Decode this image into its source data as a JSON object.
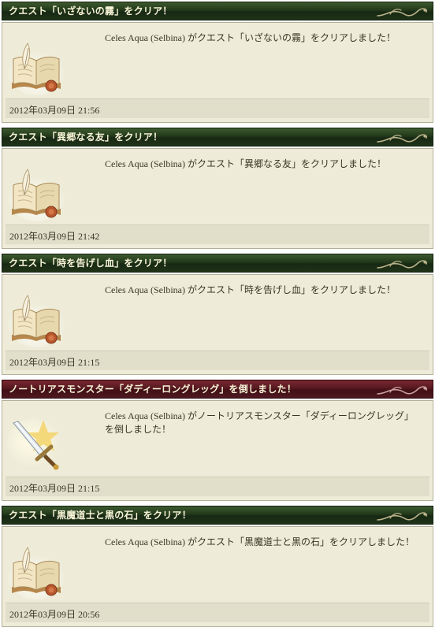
{
  "feed": {
    "items": [
      {
        "type": "quest",
        "title": "クエスト「いざないの霧」をクリア！",
        "icon": "open-book-icon",
        "message": "Celes Aqua (Selbina) がクエスト「いざないの霧」をクリアしました！",
        "timestamp": "2012年03月09日  21:56"
      },
      {
        "type": "quest",
        "title": "クエスト「異郷なる友」をクリア！",
        "icon": "open-book-icon",
        "message": "Celes Aqua (Selbina) がクエスト「異郷なる友」をクリアしました！",
        "timestamp": "2012年03月09日  21:42"
      },
      {
        "type": "quest",
        "title": "クエスト「時を告げし血」をクリア！",
        "icon": "open-book-icon",
        "message": "Celes Aqua (Selbina) がクエスト「時を告げし血」をクリアしました！",
        "timestamp": "2012年03月09日  21:15"
      },
      {
        "type": "monster",
        "title": "ノートリアスモンスター「ダディーロングレッグ」を倒しました！",
        "icon": "sword-burst-icon",
        "message": "Celes Aqua (Selbina) がノートリアスモンスター「ダディーロングレッグ」を倒しました！",
        "timestamp": "2012年03月09日  21:15"
      },
      {
        "type": "quest",
        "title": "クエスト「黒魔道士と黒の石」をクリア！",
        "icon": "open-book-icon",
        "message": "Celes Aqua (Selbina) がクエスト「黒魔道士と黒の石」をクリアしました！",
        "timestamp": "2012年03月09日  20:56"
      }
    ]
  },
  "colors": {
    "quest_header": "#22381a",
    "monster_header": "#561820",
    "header_text": "#f7f3d7",
    "body_background": "#eeecd8",
    "footer_background": "#e1dfca",
    "text": "#3a3626"
  }
}
